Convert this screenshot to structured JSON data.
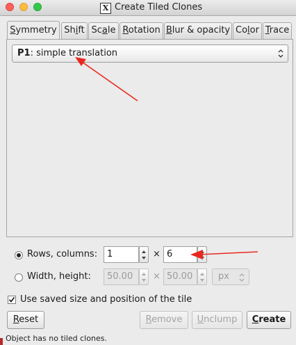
{
  "window": {
    "title": "Create Tiled Clones",
    "app_glyph": "X"
  },
  "tabs": [
    {
      "pre": "",
      "u": "S",
      "post": "ymmetry",
      "active": true
    },
    {
      "pre": "Sh",
      "u": "i",
      "post": "ft",
      "active": false
    },
    {
      "pre": "Sc",
      "u": "a",
      "post": "le",
      "active": false
    },
    {
      "pre": "",
      "u": "R",
      "post": "otation",
      "active": false
    },
    {
      "pre": "",
      "u": "B",
      "post": "lur & opacity",
      "active": false
    },
    {
      "pre": "Co",
      "u": "l",
      "post": "or",
      "active": false
    },
    {
      "pre": "",
      "u": "T",
      "post": "race",
      "active": false
    }
  ],
  "symmetry": {
    "selected_bold": "P1",
    "selected_rest": ": simple translation"
  },
  "rows_columns": {
    "label": "Rows, columns:",
    "selected": true,
    "rows": "1",
    "times": "×",
    "columns": "6"
  },
  "width_height": {
    "label": "Width, height:",
    "selected": false,
    "width": "50.00",
    "times": "×",
    "height": "50.00",
    "unit": "px"
  },
  "use_saved": {
    "label": "Use saved size and position of the tile",
    "checked": true
  },
  "buttons": {
    "reset": {
      "u": "R",
      "rest": "eset"
    },
    "remove": {
      "u": "R",
      "rest": "emove"
    },
    "unclump": {
      "u": "U",
      "rest": "nclump"
    },
    "create": {
      "u": "C",
      "rest": "reate"
    }
  },
  "status": "Object has no tiled clones.",
  "icons": {
    "close": "close-light-icon",
    "minimize": "minimize-light-icon",
    "zoom": "zoom-light-icon",
    "app": "x11-icon"
  },
  "annotation_color": "#e8281f"
}
